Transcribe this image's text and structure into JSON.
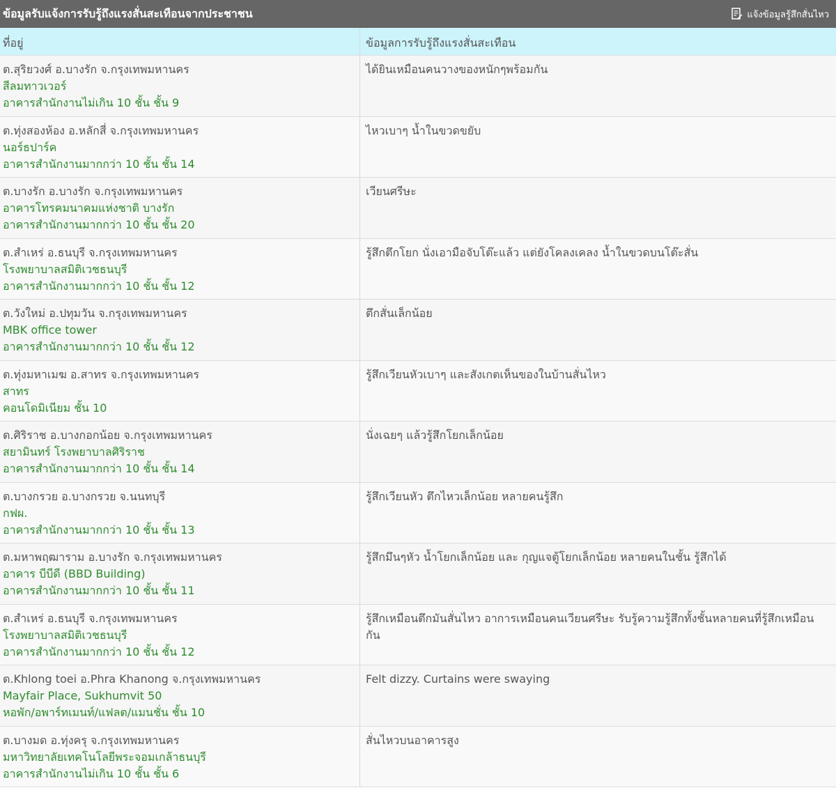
{
  "title_bar": {
    "title": "ข้อมูลรับแจ้งการรับรู้ถึงแรงสั่นสะเทือนจากประชาชน",
    "report_button_label": "แจ้งข้อมูลรู้สึกสั่นไหว",
    "report_icon": "document-edit-icon"
  },
  "table": {
    "headers": {
      "address": "ที่อยู่",
      "description": "ข้อมูลการรับรู้ถึงแรงสั่นสะเทือน"
    },
    "rows": [
      {
        "address": "ต.สุริยวงศ์ อ.บางรัก จ.กรุงเทพมหานคร",
        "place": "สีลมทาวเวอร์",
        "building": "อาคารสำนักงานไม่เกิน 10 ชั้น ชั้น 9",
        "description": "ได้ยินเหมือนคนวางของหนักๆพร้อมกัน"
      },
      {
        "address": "ต.ทุ่งสองห้อง อ.หลักสี่ จ.กรุงเทพมหานคร",
        "place": "นอร์ธปาร์ค",
        "building": "อาคารสำนักงานมากกว่า 10 ชั้น ชั้น 14",
        "description": "ไหวเบาๆ น้ำในขวดขยับ"
      },
      {
        "address": "ต.บางรัก อ.บางรัก จ.กรุงเทพมหานคร",
        "place": "อาคารโทรคมนาคมแห่งชาติ บางรัก",
        "building": "อาคารสำนักงานมากกว่า 10 ชั้น ชั้น 20",
        "description": "เวียนศรีษะ"
      },
      {
        "address": "ต.สำเหร่ อ.ธนบุรี จ.กรุงเทพมหานคร",
        "place": "โรงพยาบาลสมิติเวชธนบุรี",
        "building": "อาคารสำนักงานมากกว่า 10 ชั้น ชั้น 12",
        "description": "รู้สึกตึกโยก นั่งเอามือจับโต๊ะแล้ว แต่ยังโคลงเคลง น้ำในขวดบนโต๊ะสั่น"
      },
      {
        "address": "ต.วังใหม่ อ.ปทุมวัน จ.กรุงเทพมหานคร",
        "place": "MBK office tower",
        "building": "อาคารสำนักงานมากกว่า 10 ชั้น ชั้น 12",
        "description": "ตึกสั่นเล็กน้อย"
      },
      {
        "address": "ต.ทุ่งมหาเมฆ อ.สาทร จ.กรุงเทพมหานคร",
        "place": "สาทร",
        "building": "คอนโดมิเนียม ชั้น 10",
        "description": "รู้สึกเวียนหัวเบาๆ และสังเกตเห็นของในบ้านสั่นไหว"
      },
      {
        "address": "ต.ศิริราช อ.บางกอกน้อย จ.กรุงเทพมหานคร",
        "place": "สยามินทร์ โรงพยาบาลศิริราช",
        "building": "อาคารสำนักงานมากกว่า 10 ชั้น ชั้น 14",
        "description": "นั่งเฉยๆ แล้วรู้สึกโยกเล็กน้อย"
      },
      {
        "address": "ต.บางกรวย อ.บางกรวย จ.นนทบุรี",
        "place": "กฟผ.",
        "building": "อาคารสำนักงานมากกว่า 10 ชั้น ชั้น 13",
        "description": "รู้สึกเวียนหัว ตึกไหวเล็กน้อย หลายคนรู้สึก"
      },
      {
        "address": "ต.มหาพฤฒาราม อ.บางรัก จ.กรุงเทพมหานคร",
        "place": "อาคาร บีบีดี (BBD Building)",
        "building": "อาคารสำนักงานมากกว่า 10 ชั้น ชั้น 11",
        "description": "รู้สึกมึนๆหัว น้ำโยกเล็กน้อย และ กุญแจตู้โยกเล็กน้อย หลายคนในชั้น รู้สึกได้"
      },
      {
        "address": "ต.สำเหร่ อ.ธนบุรี จ.กรุงเทพมหานคร",
        "place": "โรงพยาบาลสมิติเวชธนบุรี",
        "building": "อาคารสำนักงานมากกว่า 10 ชั้น ชั้น 12",
        "description": "รู้สึกเหมือนตึกมันสั่นไหว อาการเหมือนคนเวียนศรีษะ รับรู้ความรู้สึกทั้งชั้นหลายคนที่รู้สึกเหมือนกัน"
      },
      {
        "address": "ต.Khlong toei อ.Phra Khanong จ.กรุงเทพมหานคร",
        "place": "Mayfair Place, Sukhumvit 50",
        "building": "หอพัก/อพาร์ทเมนท์/แฟลต/แมนชั่น ชั้น 10",
        "description": "Felt dizzy. Curtains were swaying"
      },
      {
        "address": "ต.บางมด อ.ทุ่งครุ จ.กรุงเทพมหานคร",
        "place": "มหาวิทยาลัยเทคโนโลยีพระจอมเกล้าธนบุรี",
        "building": "อาคารสำนักงานไม่เกิน 10 ชั้น ชั้น 6",
        "description": "สั่นไหวบนอาคารสูง"
      }
    ]
  }
}
